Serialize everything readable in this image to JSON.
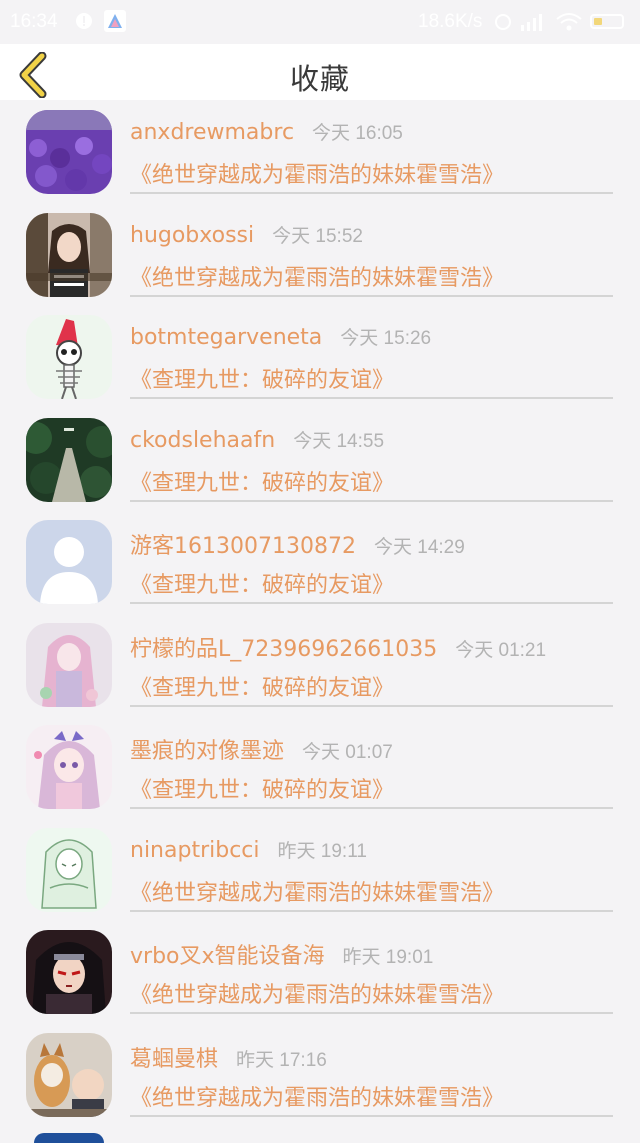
{
  "status_bar": {
    "time": "16:34",
    "speed": "18.6K/s",
    "battery_level": 0.3
  },
  "header": {
    "title": "收藏",
    "back_icon": "chevron-left-icon",
    "accent": "#f1d247"
  },
  "colors": {
    "name": "#e79a62",
    "time": "#b3b3b3",
    "book": "#e79a62"
  },
  "favorites": [
    {
      "name": "anxdrewmabrc",
      "time": "今天 16:05",
      "book": "《绝世穿越成为霍雨浩的妹妹霍雪浩》"
    },
    {
      "name": "hugobxossi",
      "time": "今天 15:52",
      "book": "《绝世穿越成为霍雨浩的妹妹霍雪浩》"
    },
    {
      "name": "botmtegarveneta",
      "time": "今天 15:26",
      "book": "《查理九世：破碎的友谊》"
    },
    {
      "name": "ckodslehaafn",
      "time": "今天 14:55",
      "book": "《查理九世：破碎的友谊》"
    },
    {
      "name": "游客1613007130872",
      "time": "今天 14:29",
      "book": "《查理九世：破碎的友谊》"
    },
    {
      "name": "柠檬的品L_72396962661035",
      "time": "今天 01:21",
      "book": "《查理九世：破碎的友谊》"
    },
    {
      "name": "墨痕的对像墨迹",
      "time": "今天 01:07",
      "book": "《查理九世：破碎的友谊》"
    },
    {
      "name": "ninaptribcci",
      "time": "昨天 19:11",
      "book": "《绝世穿越成为霍雨浩的妹妹霍雪浩》"
    },
    {
      "name": "vrbo叉x智能设备海",
      "time": "昨天 19:01",
      "book": "《绝世穿越成为霍雨浩的妹妹霍雪浩》"
    },
    {
      "name": "葛蝈曼棋",
      "time": "昨天 17:16",
      "book": "《绝世穿越成为霍雨浩的妹妹霍雪浩》"
    }
  ]
}
